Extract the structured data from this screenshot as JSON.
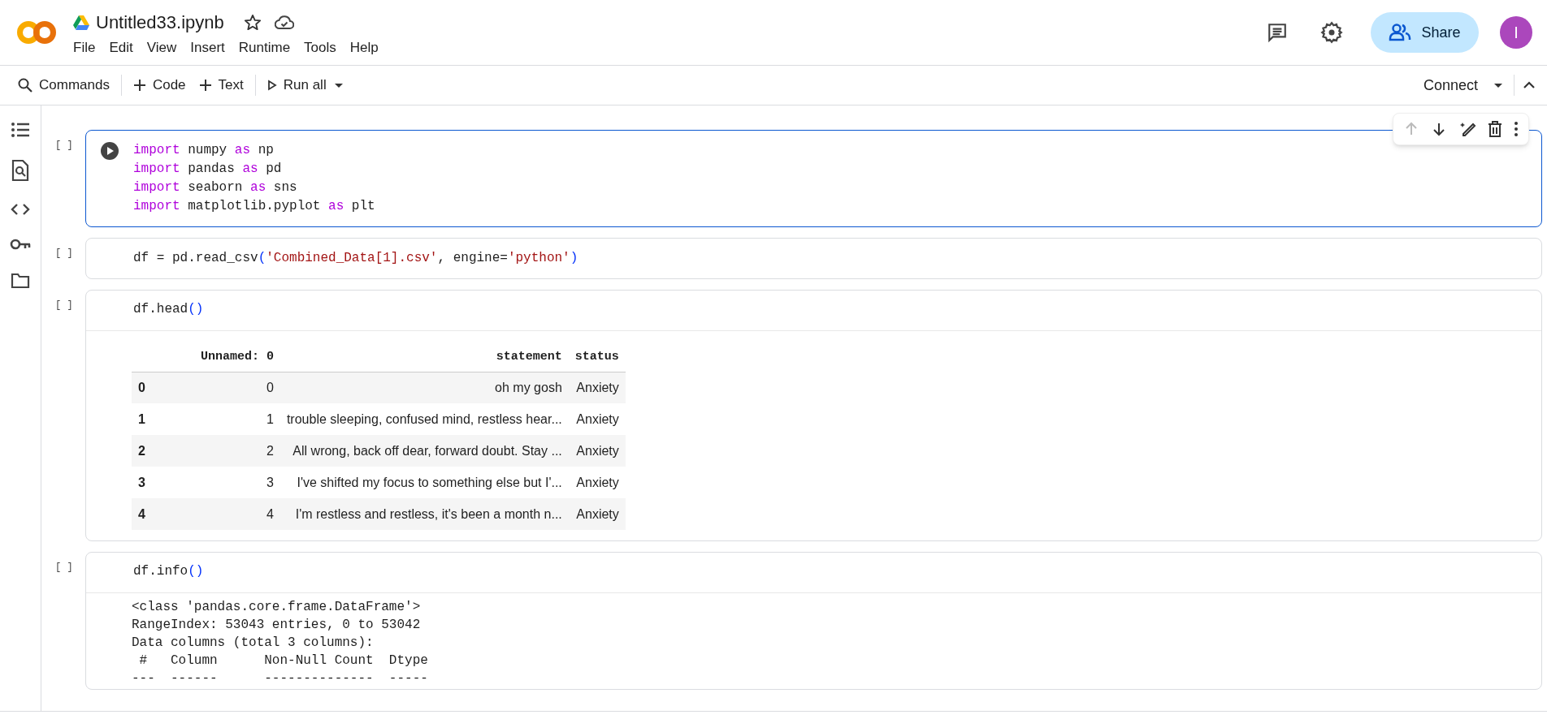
{
  "notebook": {
    "title": "Untitled33.ipynb",
    "starred": false,
    "saved_to_cloud": true
  },
  "menu": [
    "File",
    "Edit",
    "View",
    "Insert",
    "Runtime",
    "Tools",
    "Help"
  ],
  "header_actions": {
    "share_label": "Share",
    "avatar_initial": "I"
  },
  "toolbar": {
    "items": [
      {
        "kind": "search",
        "label": "Commands"
      },
      {
        "kind": "add",
        "label": "Code"
      },
      {
        "kind": "add",
        "label": "Text"
      },
      {
        "kind": "run",
        "label": "Run all"
      }
    ],
    "connect_label": "Connect"
  },
  "cell_toolbar": {
    "move_up_disabled": true
  },
  "cells": [
    {
      "count": "[ ]",
      "focused": true,
      "lines": [
        [
          {
            "t": "import",
            "kind": "keyword"
          },
          {
            "t": " numpy ",
            "kind": "plain"
          },
          {
            "t": "as",
            "kind": "keyword"
          },
          {
            "t": " np",
            "kind": "plain"
          }
        ],
        [
          {
            "t": "import",
            "kind": "keyword"
          },
          {
            "t": " pandas ",
            "kind": "plain"
          },
          {
            "t": "as",
            "kind": "keyword"
          },
          {
            "t": " pd",
            "kind": "plain"
          }
        ],
        [
          {
            "t": "import",
            "kind": "keyword"
          },
          {
            "t": " seaborn ",
            "kind": "plain"
          },
          {
            "t": "as",
            "kind": "keyword"
          },
          {
            "t": " sns",
            "kind": "plain"
          }
        ],
        [
          {
            "t": "import",
            "kind": "keyword"
          },
          {
            "t": " matplotlib.pyplot ",
            "kind": "plain"
          },
          {
            "t": "as",
            "kind": "keyword"
          },
          {
            "t": " plt",
            "kind": "plain"
          }
        ]
      ]
    },
    {
      "count": "[ ]",
      "focused": false,
      "lines": [
        [
          {
            "t": "df = pd.read_csv",
            "kind": "plain"
          },
          {
            "t": "(",
            "kind": "bracket"
          },
          {
            "t": "'Combined_Data[1].csv'",
            "kind": "string"
          },
          {
            "t": ", engine=",
            "kind": "plain"
          },
          {
            "t": "'python'",
            "kind": "string"
          },
          {
            "t": ")",
            "kind": "bracket"
          }
        ]
      ]
    },
    {
      "count": "[ ]",
      "focused": false,
      "lines": [
        [
          {
            "t": "df.head",
            "kind": "plain"
          },
          {
            "t": "()",
            "kind": "bracket"
          }
        ]
      ],
      "output": {
        "kind": "table",
        "columns": [
          "",
          "Unnamed: 0",
          "statement",
          "status"
        ],
        "rows": [
          [
            "0",
            "0",
            "oh my gosh",
            "Anxiety"
          ],
          [
            "1",
            "1",
            "trouble sleeping, confused mind, restless hear...",
            "Anxiety"
          ],
          [
            "2",
            "2",
            "All wrong, back off dear, forward doubt. Stay ...",
            "Anxiety"
          ],
          [
            "3",
            "3",
            "I've shifted my focus to something else but I'...",
            "Anxiety"
          ],
          [
            "4",
            "4",
            "I'm restless and restless, it's been a month n...",
            "Anxiety"
          ]
        ]
      }
    },
    {
      "count": "[ ]",
      "focused": false,
      "lines": [
        [
          {
            "t": "df.info",
            "kind": "plain"
          },
          {
            "t": "()",
            "kind": "bracket"
          }
        ]
      ],
      "output": {
        "kind": "text",
        "lines": [
          "<class 'pandas.core.frame.DataFrame'>",
          "RangeIndex: 53043 entries, 0 to 53042",
          "Data columns (total 3 columns):",
          " #   Column      Non-Null Count  Dtype ",
          "---  ------      --------------  ----- "
        ]
      }
    }
  ]
}
